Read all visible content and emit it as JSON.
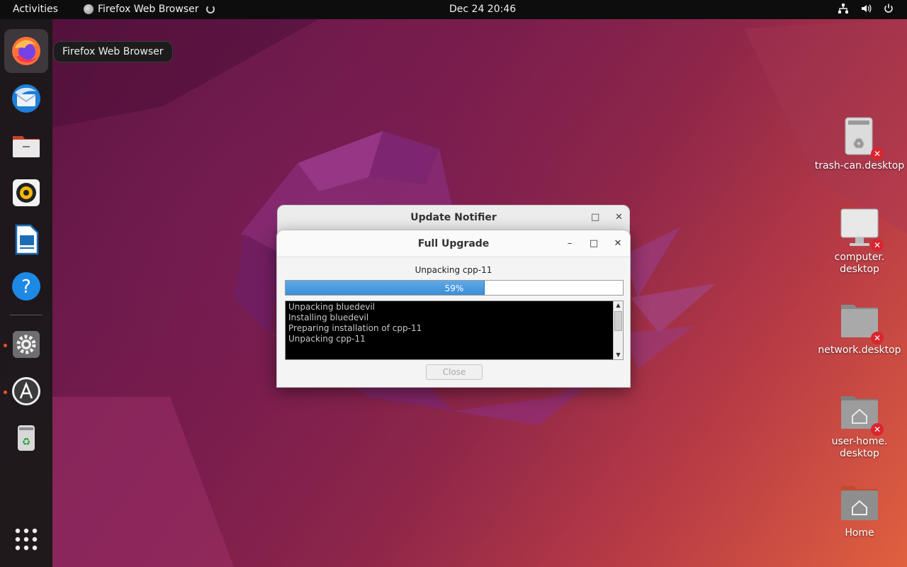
{
  "topbar": {
    "activities": "Activities",
    "app_name": "Firefox Web Browser",
    "clock": "Dec 24  20:46",
    "icons": [
      "network-icon",
      "volume-icon",
      "power-icon"
    ]
  },
  "dock": {
    "items": [
      {
        "name": "firefox",
        "icon": "firefox-icon",
        "active": true
      },
      {
        "name": "thunderbird",
        "icon": "thunderbird-icon"
      },
      {
        "name": "files",
        "icon": "files-icon"
      },
      {
        "name": "rhythmbox",
        "icon": "rhythmbox-icon"
      },
      {
        "name": "libreoffice-writer",
        "icon": "writer-icon"
      },
      {
        "name": "help",
        "icon": "help-icon"
      },
      {
        "name": "settings",
        "icon": "gear-icon",
        "running": true
      },
      {
        "name": "software-updater",
        "icon": "software-updater-icon",
        "running": true
      },
      {
        "name": "trash",
        "icon": "trash-icon"
      },
      {
        "name": "show-apps",
        "icon": "app-grid-icon"
      }
    ],
    "accent": "#e95420"
  },
  "tooltip": {
    "text": "Firefox Web Browser"
  },
  "desktop": {
    "icons": [
      {
        "label": "trash-can.desktop",
        "icon": "trash-icon",
        "broken": true
      },
      {
        "label": "computer.\ndesktop",
        "icon": "computer-icon",
        "broken": true
      },
      {
        "label": "network.desktop",
        "icon": "network-icon",
        "broken": true
      },
      {
        "label": "user-home.\ndesktop",
        "icon": "home-folder-icon",
        "broken": true
      },
      {
        "label": "Home",
        "icon": "home-folder-icon",
        "broken": false
      }
    ]
  },
  "back_window": {
    "title": "Update Notifier"
  },
  "dialog": {
    "title": "Full Upgrade",
    "status": "Unpacking cpp-11",
    "progress": {
      "value": 0.59,
      "label": "59%"
    },
    "log_lines": [
      "Unpacking bluedevil",
      "Installing bluedevil",
      "Preparing installation of cpp-11",
      "Unpacking cpp-11"
    ],
    "close_label": "Close",
    "close_enabled": false,
    "minimize_glyph": "–",
    "maximize_glyph": "□",
    "close_glyph": "✕"
  },
  "colors": {
    "progress_fill": "#3b8fd7",
    "badge": "#d9252f",
    "topbar": "#0d0d0d"
  }
}
